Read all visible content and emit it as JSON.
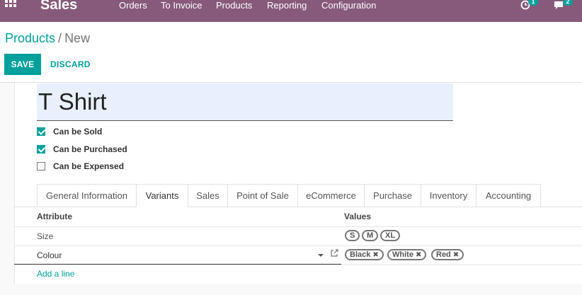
{
  "navbar": {
    "app_name": "Sales",
    "menu": [
      "Orders",
      "To Invoice",
      "Products",
      "Reporting",
      "Configuration"
    ],
    "activity_count": "1",
    "message_count": "2",
    "icons": [
      "apps-grid-icon",
      "clock-icon",
      "chat-icon"
    ]
  },
  "breadcrumb": {
    "parent": "Products",
    "separator": "/",
    "current": "New"
  },
  "actions": {
    "save": "SAVE",
    "discard": "DISCARD"
  },
  "product": {
    "name": "T Shirt",
    "checkboxes": [
      {
        "label": "Can be Sold",
        "checked": true
      },
      {
        "label": "Can be Purchased",
        "checked": true
      },
      {
        "label": "Can be Expensed",
        "checked": false
      }
    ]
  },
  "tabs": [
    "General Information",
    "Variants",
    "Sales",
    "Point of Sale",
    "eCommerce",
    "Purchase",
    "Inventory",
    "Accounting"
  ],
  "active_tab": "Variants",
  "variants": {
    "headers": {
      "attribute": "Attribute",
      "values": "Values"
    },
    "rows": [
      {
        "attribute": "Size",
        "values": [
          "S",
          "M",
          "XL"
        ]
      },
      {
        "attribute": "Colour",
        "values": [
          "Black",
          "White",
          "Red"
        ]
      }
    ],
    "add_line": "Add a line"
  },
  "colors": {
    "brand": "#875a7b",
    "accent": "#00a09d",
    "input_bg": "#e8f0fe"
  }
}
